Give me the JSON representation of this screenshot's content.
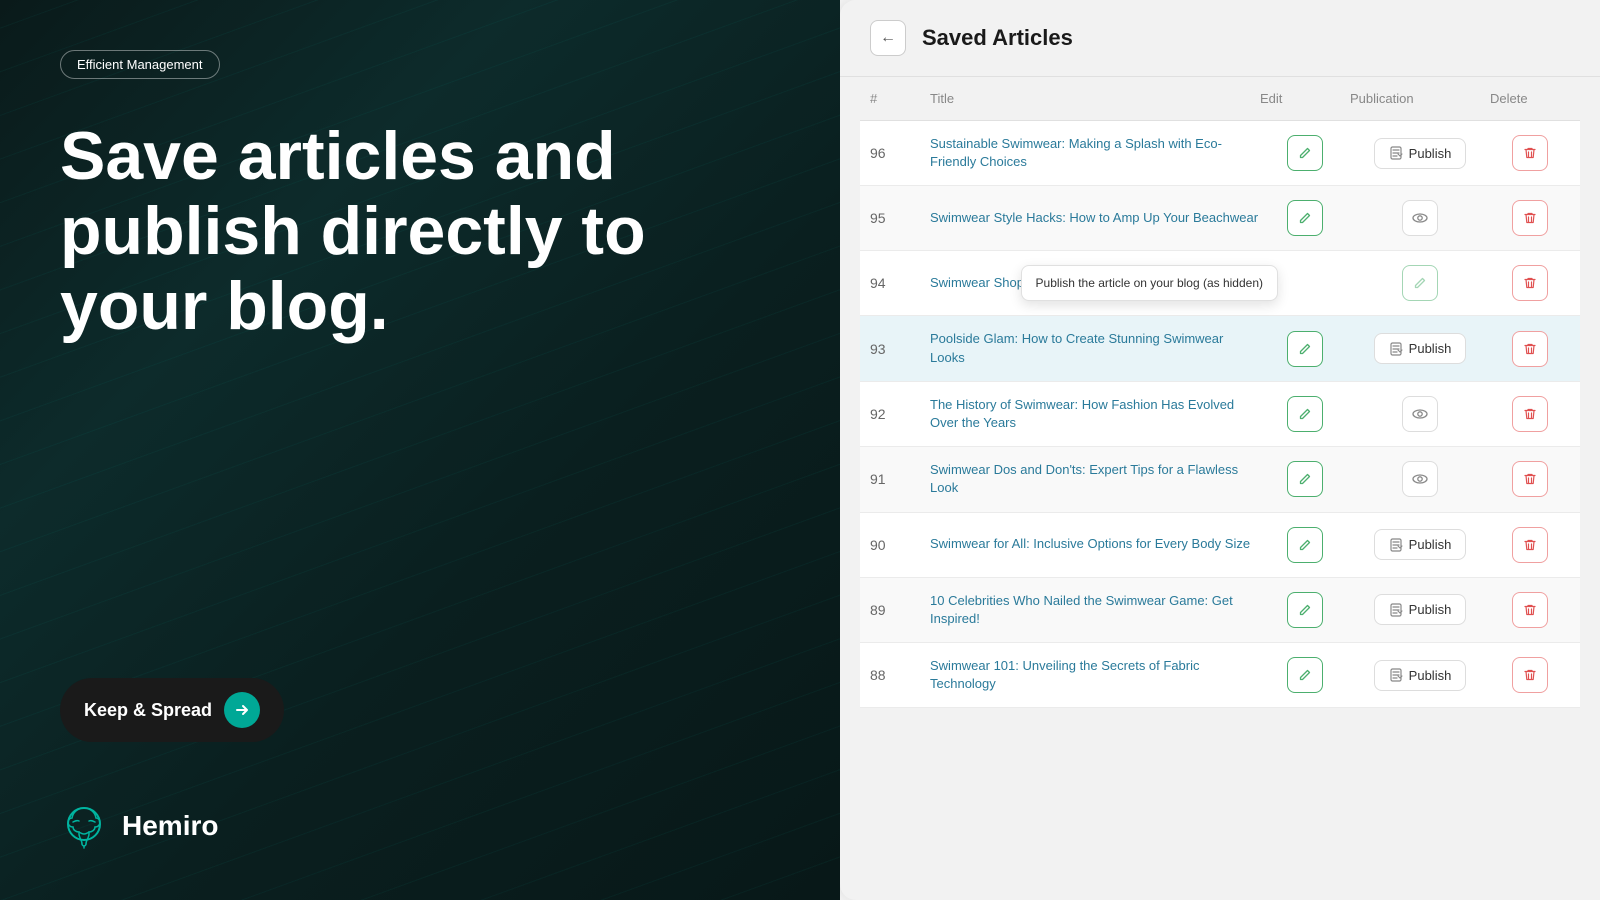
{
  "left": {
    "badge": "Efficient Management",
    "hero_title": "Save articles and publish directly to your blog.",
    "keep_spread_btn": "Keep & Spread",
    "logo_text": "Hemiro"
  },
  "right": {
    "panel_title": "Saved Articles",
    "back_btn_label": "←",
    "table_headers": {
      "num": "#",
      "title": "Title",
      "edit": "Edit",
      "publication": "Publication",
      "delete": "Delete"
    },
    "tooltip_text": "Publish the article on your blog (as hidden)",
    "articles": [
      {
        "num": "96",
        "title": "Sustainable Swimwear: Making a Splash with Eco-Friendly Choices",
        "has_publish": true,
        "has_eye": false,
        "highlighted": false
      },
      {
        "num": "95",
        "title": "Swimwear Style Hacks: How to Amp Up Your Beachwear",
        "has_publish": false,
        "has_eye": true,
        "highlighted": false
      },
      {
        "num": "94",
        "title": "Swimwear Shopping 101: Your Essential Checklist",
        "has_publish": false,
        "has_eye": false,
        "highlighted": false,
        "show_tooltip": true
      },
      {
        "num": "93",
        "title": "Poolside Glam: How to Create Stunning Swimwear Looks",
        "has_publish": true,
        "has_eye": false,
        "highlighted": true
      },
      {
        "num": "92",
        "title": "The History of Swimwear: How Fashion Has Evolved Over the Years",
        "has_publish": false,
        "has_eye": true,
        "highlighted": false
      },
      {
        "num": "91",
        "title": "Swimwear Dos and Don'ts: Expert Tips for a Flawless Look",
        "has_publish": false,
        "has_eye": true,
        "highlighted": false
      },
      {
        "num": "90",
        "title": "Swimwear for All: Inclusive Options for Every Body Size",
        "has_publish": true,
        "has_eye": false,
        "highlighted": false
      },
      {
        "num": "89",
        "title": "10 Celebrities Who Nailed the Swimwear Game: Get Inspired!",
        "has_publish": true,
        "has_eye": false,
        "highlighted": false
      },
      {
        "num": "88",
        "title": "Swimwear 101: Unveiling the Secrets of Fabric Technology",
        "has_publish": true,
        "has_eye": false,
        "highlighted": false
      }
    ],
    "publish_label": "Publish"
  }
}
